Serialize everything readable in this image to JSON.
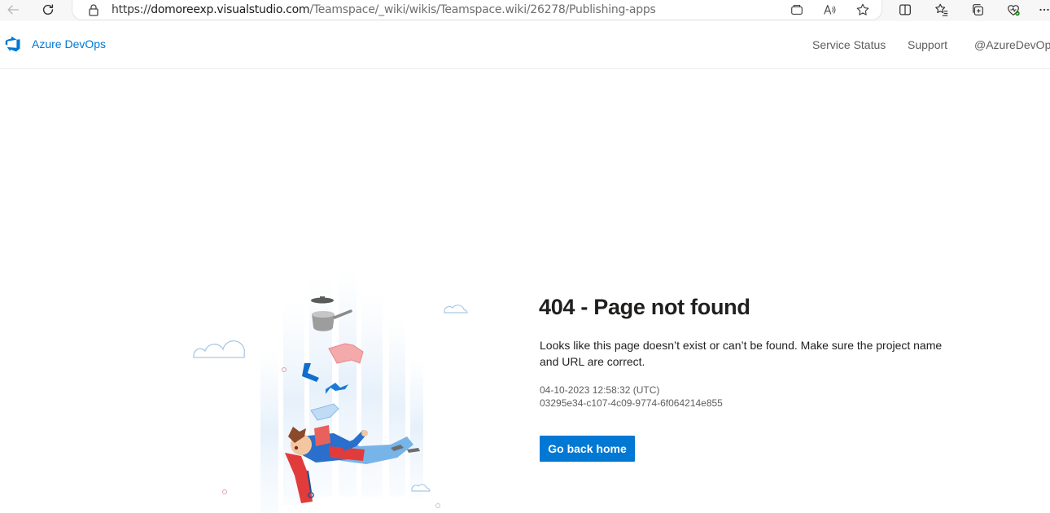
{
  "browser": {
    "url_prefix": "https://",
    "url_host": "domoreexp.visualstudio.com",
    "url_path": "/Teamspace/_wiki/wikis/Teamspace.wiki/26278/Publishing-apps"
  },
  "header": {
    "brand": "Azure DevOps",
    "links": [
      "Service Status",
      "Support",
      "@AzureDevOps"
    ]
  },
  "error": {
    "title": "404 - Page not found",
    "description": "Looks like this page doesn’t exist or can’t be found. Make sure the project name and URL are correct.",
    "timestamp": "04-10-2023 12:58:32 (UTC)",
    "activity_id": "03295e34-c107-4c09-9774-6f064214e855",
    "button_label": "Go back home"
  },
  "colors": {
    "accent": "#0078d4",
    "title": "#201f1e",
    "muted": "#605e5c"
  },
  "icons": [
    "back-arrow-icon",
    "refresh-icon",
    "lock-icon",
    "tab-icon",
    "read-aloud-icon",
    "favorite-star-icon",
    "split-screen-icon",
    "favorites-icon",
    "collections-icon",
    "browser-essentials-icon",
    "more-icon",
    "azure-devops-logo"
  ]
}
